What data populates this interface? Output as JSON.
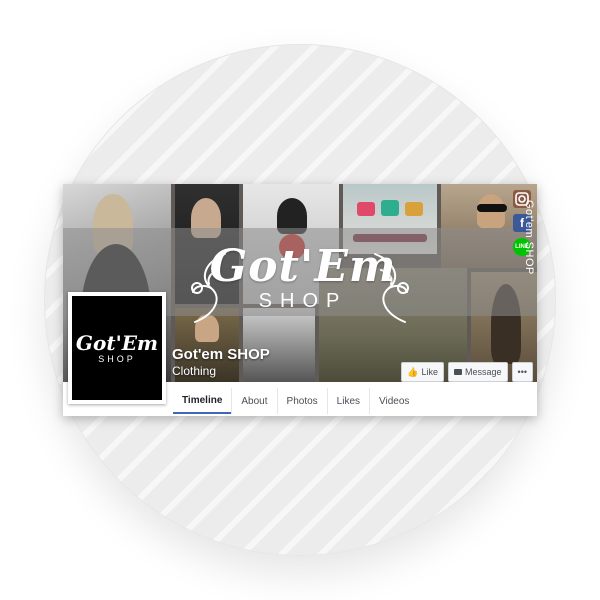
{
  "brand": {
    "logo_word": "Got'Em",
    "logo_sub": "SHOP"
  },
  "page": {
    "name": "Got'em SHOP",
    "category": "Clothing",
    "vertical_name": "Got'em SHOP"
  },
  "social": [
    {
      "icon": "instagram-icon",
      "color": "#8a5a44"
    },
    {
      "icon": "facebook-icon",
      "glyph": "f",
      "color": "#3b5998"
    },
    {
      "icon": "line-icon",
      "glyph": "LINE",
      "color": "#00c300"
    }
  ],
  "actions": {
    "like_label": "Like",
    "message_label": "Message",
    "more_label": "•••"
  },
  "tabs": [
    {
      "label": "Timeline",
      "active": true
    },
    {
      "label": "About",
      "active": false
    },
    {
      "label": "Photos",
      "active": false
    },
    {
      "label": "Likes",
      "active": false
    },
    {
      "label": "Videos",
      "active": false
    }
  ],
  "colors": {
    "accent": "#4267b2",
    "facebook": "#3b5998"
  }
}
